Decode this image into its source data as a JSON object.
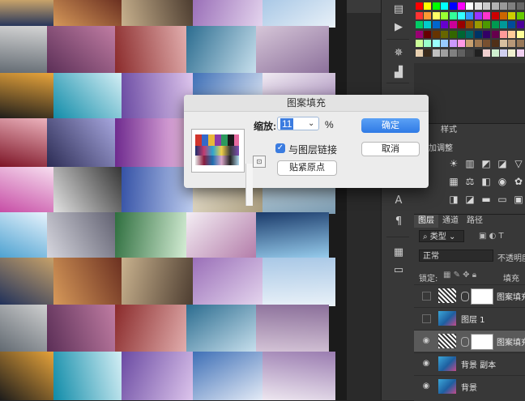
{
  "dialog": {
    "title": "图案填充",
    "scale_label": "缩放:",
    "scale_value": "11",
    "percent": "%",
    "link_label": "与图层链接",
    "link_checked": true,
    "snap_button": "贴紧原点",
    "ok_button": "确定",
    "cancel_button": "取消"
  },
  "adjustments_panel": {
    "tabs": [
      "...",
      "样式"
    ],
    "add_label": "加调整"
  },
  "layers_panel": {
    "tabs": [
      "图层",
      "通道",
      "路径"
    ],
    "filter_kind": "类型",
    "blend_mode": "正常",
    "opacity_label": "不透明度",
    "lock_label": "锁定:",
    "fill_label": "填充",
    "layers": [
      {
        "name": "图案填充",
        "visible": false,
        "thumb": "pattern",
        "mask": true,
        "selected": false
      },
      {
        "name": "图层 1",
        "visible": false,
        "thumb": "image",
        "mask": false,
        "selected": false
      },
      {
        "name": "图案填充",
        "visible": true,
        "thumb": "pattern",
        "mask": true,
        "selected": true
      },
      {
        "name": "背景 副本",
        "visible": true,
        "thumb": "image",
        "mask": false,
        "selected": false
      },
      {
        "name": "背景",
        "visible": true,
        "thumb": "image",
        "mask": false,
        "selected": false
      }
    ]
  },
  "toolstrip": {
    "icons": [
      "history-icon",
      "play-icon",
      "compass-icon",
      "histogram-icon",
      "info-icon",
      "paragraph-icon",
      "character-icon",
      "notes-icon",
      "clipboard-icon"
    ]
  },
  "colors": {
    "accent": "#3b7ce0",
    "panel_bg": "#383838",
    "selected_row": "#5a5a5a"
  }
}
